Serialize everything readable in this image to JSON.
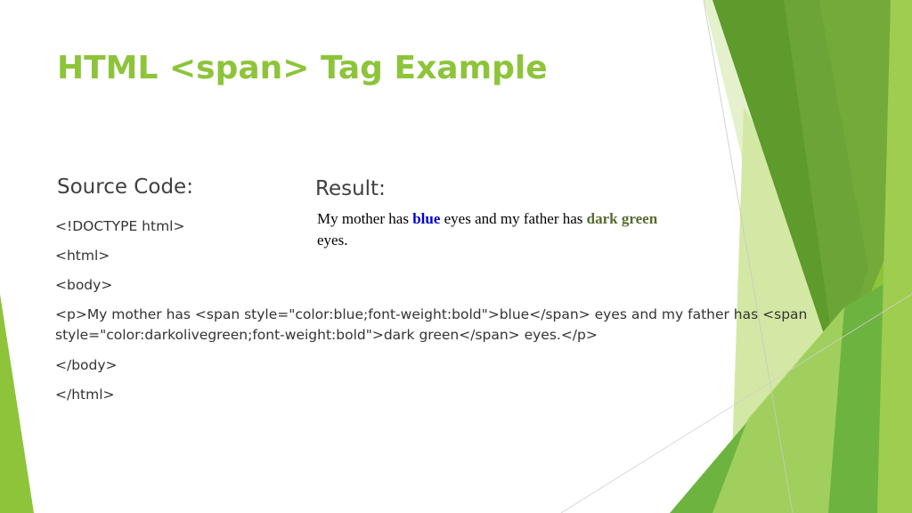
{
  "slide": {
    "title": "HTML <span> Tag Example",
    "source_heading": "Source Code:",
    "result_heading": "Result:",
    "source_lines": [
      "<!DOCTYPE html>",
      "<html>",
      "<body>",
      "<p>My mother has <span style=\"color:blue;font-weight:bold\">blue</span> eyes and my father has <span style=\"color:darkolivegreen;font-weight:bold\">dark green</span> eyes.</p>",
      "</body>",
      "</html>"
    ],
    "result": {
      "part1": "My mother has ",
      "highlight1": "blue",
      "part2": " eyes and my father has ",
      "highlight2": "dark green",
      "part3": " eyes."
    }
  },
  "colors": {
    "title": "#8dc43a",
    "highlight_blue": "#0000cc",
    "highlight_green": "#556b2f",
    "accent_light": "#d5e8a8",
    "accent_mid": "#8dc43a",
    "accent_dark": "#5f9b2c"
  }
}
